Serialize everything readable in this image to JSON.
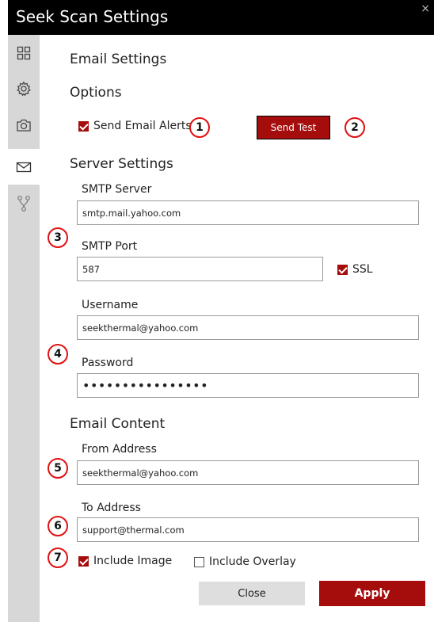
{
  "window": {
    "title": "Seek Scan Settings",
    "close_glyph": "×"
  },
  "sidebar": {
    "items": [
      {
        "icon": "grid-icon",
        "active": false
      },
      {
        "icon": "gear-icon",
        "active": false
      },
      {
        "icon": "camera-icon",
        "active": false
      },
      {
        "icon": "mail-icon",
        "active": true
      },
      {
        "icon": "branch-icon",
        "active": false
      }
    ]
  },
  "page": {
    "title": "Email Settings",
    "options": {
      "heading": "Options",
      "send_alerts_label": "Send Email Alerts",
      "send_alerts_checked": true,
      "send_test_label": "Send Test"
    },
    "server": {
      "heading": "Server Settings",
      "smtp_server_label": "SMTP Server",
      "smtp_server_value": "smtp.mail.yahoo.com",
      "smtp_port_label": "SMTP Port",
      "smtp_port_value": "587",
      "ssl_label": "SSL",
      "ssl_checked": true,
      "username_label": "Username",
      "username_value": "seekthermal@yahoo.com",
      "password_label": "Password",
      "password_value": "••••••••••••••••"
    },
    "content": {
      "heading": "Email Content",
      "from_label": "From Address",
      "from_value": "seekthermal@yahoo.com",
      "to_label": "To Address",
      "to_value": "support@thermal.com",
      "include_image_label": "Include Image",
      "include_image_checked": true,
      "include_overlay_label": "Include Overlay",
      "include_overlay_checked": false
    },
    "buttons": {
      "close_label": "Close",
      "apply_label": "Apply"
    }
  },
  "badges": [
    "1",
    "2",
    "3",
    "4",
    "5",
    "6",
    "7"
  ],
  "colors": {
    "accent": "#a50d0d",
    "badge_ring": "#e01010",
    "titlebar": "#000000",
    "sidebar": "#d7d7d7"
  }
}
